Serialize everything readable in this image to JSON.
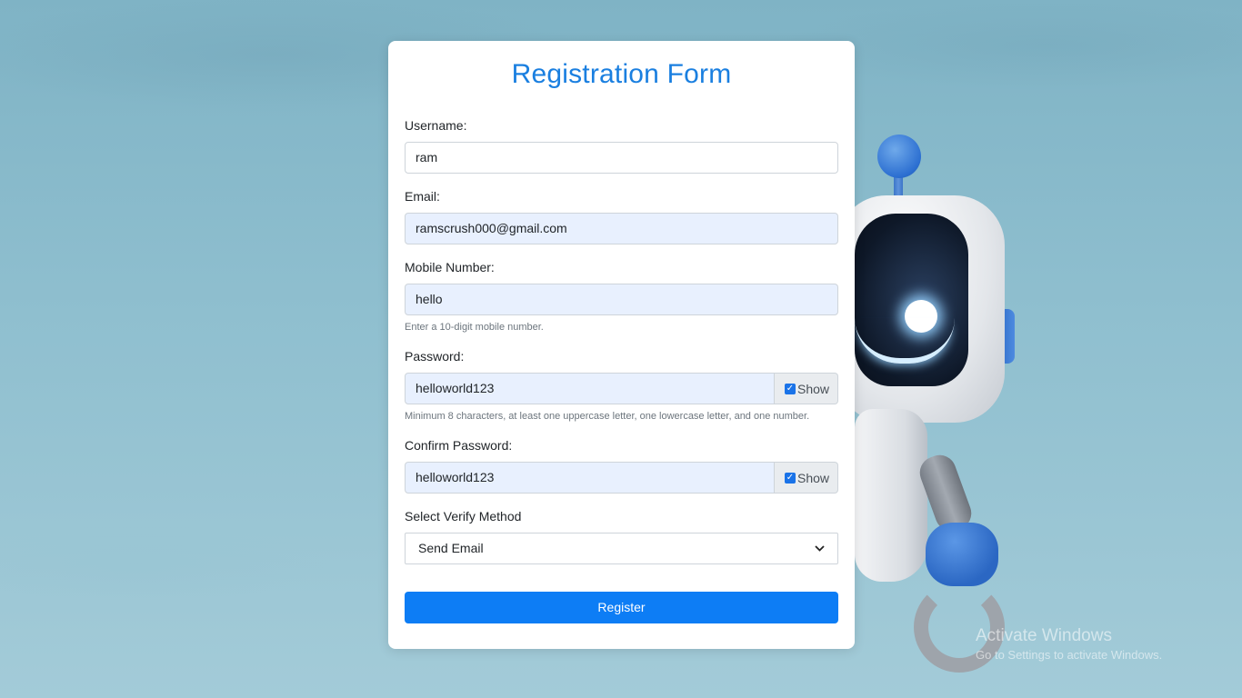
{
  "form": {
    "title": "Registration Form",
    "username": {
      "label": "Username:",
      "value": "ram"
    },
    "email": {
      "label": "Email:",
      "value": "ramscrush000@gmail.com"
    },
    "mobile": {
      "label": "Mobile Number:",
      "value": "hello",
      "hint": "Enter a 10-digit mobile number."
    },
    "password": {
      "label": "Password:",
      "value": "helloworld123",
      "toggle_label": "Show",
      "toggle_checked": true,
      "hint": "Minimum 8 characters, at least one uppercase letter, one lowercase letter, and one number."
    },
    "confirm_password": {
      "label": "Confirm Password:",
      "value": "helloworld123",
      "toggle_label": "Show",
      "toggle_checked": true
    },
    "verify_method": {
      "label": "Select Verify Method",
      "selected": "Send Email"
    },
    "submit_label": "Register"
  },
  "watermark": {
    "title": "Activate Windows",
    "subtitle": "Go to Settings to activate Windows."
  },
  "colors": {
    "accent": "#0d7df5",
    "title": "#1a7fe0",
    "autofill": "#e8f0fe"
  },
  "icons": {
    "checkbox": "checkmark-icon",
    "select": "chevron-down-icon"
  }
}
